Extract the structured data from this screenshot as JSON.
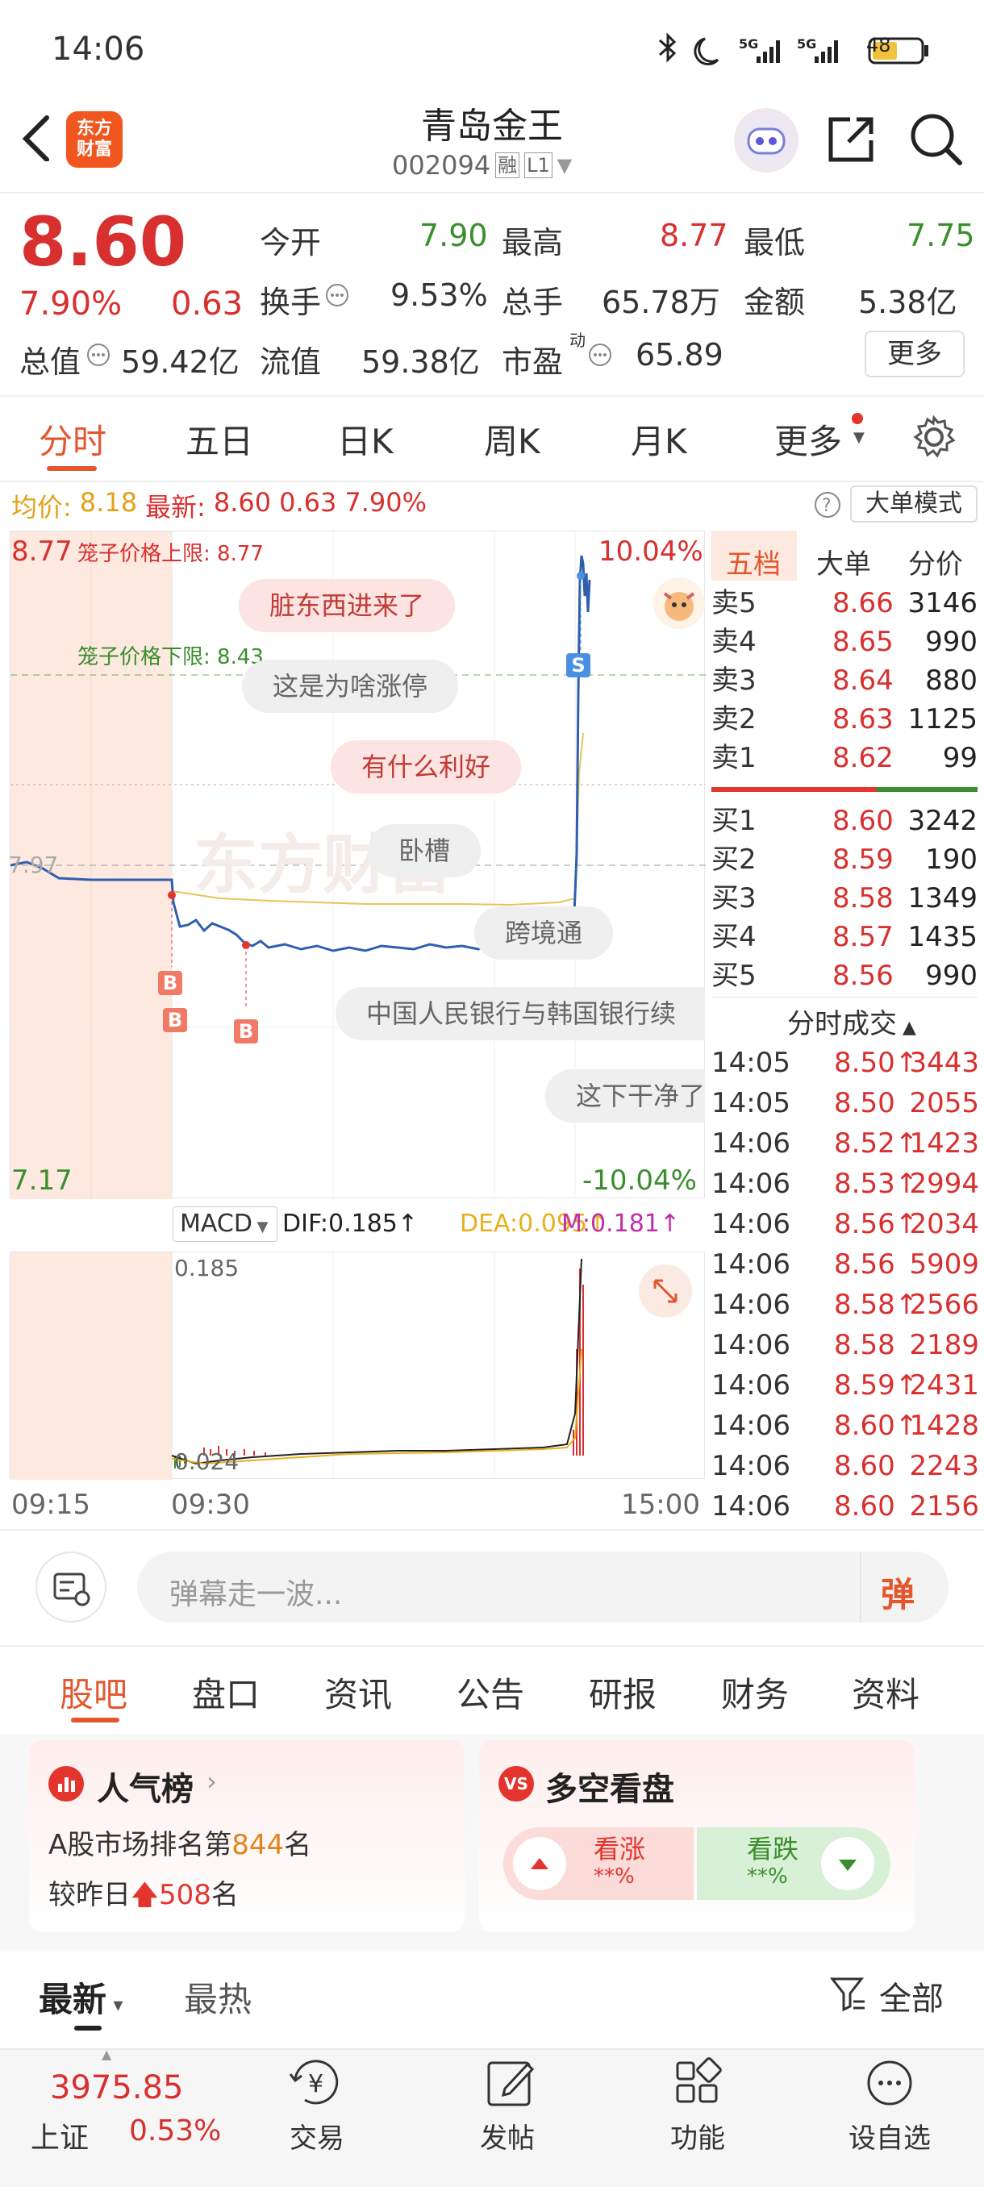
{
  "status_bar": {
    "time": "14:06",
    "network1": "5G",
    "network2": "5G",
    "battery": "48"
  },
  "header": {
    "logo_text_1": "东方",
    "logo_text_2": "财富",
    "title": "青岛金王",
    "code": "002094",
    "tag1": "融",
    "tag2": "L1"
  },
  "quote": {
    "price": "8.60",
    "change_pct": "7.90%",
    "change": "0.63",
    "open_label": "今开",
    "open": "7.90",
    "high_label": "最高",
    "high": "8.77",
    "low_label": "最低",
    "low": "7.75",
    "turnover_label": "换手",
    "turnover": "9.53%",
    "volume_label": "总手",
    "volume": "65.78万",
    "amount_label": "金额",
    "amount": "5.38亿",
    "mktcap_label": "总值",
    "mktcap": "59.42亿",
    "float_label": "流值",
    "float": "59.38亿",
    "pe_label": "市盈",
    "pe_sup": "动",
    "pe": "65.89",
    "more_button": "更多"
  },
  "tabs": {
    "t1": "分时",
    "t2": "五日",
    "t3": "日K",
    "t4": "周K",
    "t5": "月K",
    "t6": "更多"
  },
  "info_line": {
    "avg_label": "均价:",
    "avg": "8.18",
    "latest_label": "最新:",
    "latest": "8.60",
    "chg": "0.63",
    "pct": "7.90%",
    "mode_button": "大单模式"
  },
  "chart": {
    "top_price": "8.77",
    "top_pct": "10.04%",
    "bottom_price": "7.17",
    "bottom_pct": "-10.04%",
    "prev_close": "7.97",
    "upper_limit_label": "笼子价格上限: 8.77",
    "lower_limit_label": "笼子价格下限: 8.43",
    "watermark": "东方财富",
    "danmaku": [
      "脏东西进来了",
      "这是为啥涨停",
      "有什么利好",
      "卧槽",
      "跨境通",
      "中国人民银行与韩国银行续",
      "这下干净了"
    ],
    "x_start": "09:15",
    "x_mid": "09:30",
    "x_end": "15:00",
    "marker_b": "B",
    "marker_s": "S"
  },
  "macd": {
    "selector": "MACD",
    "dif": "DIF:0.185↑",
    "dea": "DEA:0.095↑",
    "m": "M:0.181↑",
    "top": "0.185",
    "bottom": "0.024"
  },
  "orderbook": {
    "tab1": "五档",
    "tab2": "大单",
    "tab3": "分价",
    "asks": [
      {
        "label": "卖5",
        "price": "8.66",
        "vol": "3146"
      },
      {
        "label": "卖4",
        "price": "8.65",
        "vol": "990"
      },
      {
        "label": "卖3",
        "price": "8.64",
        "vol": "880"
      },
      {
        "label": "卖2",
        "price": "8.63",
        "vol": "1125"
      },
      {
        "label": "卖1",
        "price": "8.62",
        "vol": "99"
      }
    ],
    "bids": [
      {
        "label": "买1",
        "price": "8.60",
        "vol": "3242"
      },
      {
        "label": "买2",
        "price": "8.59",
        "vol": "190"
      },
      {
        "label": "买3",
        "price": "8.58",
        "vol": "1349"
      },
      {
        "label": "买4",
        "price": "8.57",
        "vol": "1435"
      },
      {
        "label": "买5",
        "price": "8.56",
        "vol": "990"
      }
    ],
    "trades_title": "分时成交",
    "trades": [
      {
        "t": "14:05",
        "p": "8.50↑",
        "v": "3443"
      },
      {
        "t": "14:05",
        "p": "8.50",
        "v": "2055"
      },
      {
        "t": "14:06",
        "p": "8.52↑",
        "v": "1423"
      },
      {
        "t": "14:06",
        "p": "8.53↑",
        "v": "2994"
      },
      {
        "t": "14:06",
        "p": "8.56↑",
        "v": "2034"
      },
      {
        "t": "14:06",
        "p": "8.56",
        "v": "5909"
      },
      {
        "t": "14:06",
        "p": "8.58↑",
        "v": "2566"
      },
      {
        "t": "14:06",
        "p": "8.58",
        "v": "2189"
      },
      {
        "t": "14:06",
        "p": "8.59↑",
        "v": "2431"
      },
      {
        "t": "14:06",
        "p": "8.60↑",
        "v": "1428"
      },
      {
        "t": "14:06",
        "p": "8.60",
        "v": "2243"
      },
      {
        "t": "14:06",
        "p": "8.60",
        "v": "2156"
      }
    ]
  },
  "danmaku_input": {
    "placeholder": "弹幕走一波...",
    "button": "弹"
  },
  "section_tabs": [
    "股吧",
    "盘口",
    "资讯",
    "公告",
    "研报",
    "财务",
    "资料"
  ],
  "popularity": {
    "title": "人气榜",
    "line1_prefix": "A股市场排名第",
    "rank": "844",
    "line1_suffix": "名",
    "line2_prefix": "较昨日",
    "change": "508",
    "line2_suffix": "名"
  },
  "sentiment": {
    "title": "多空看盘",
    "up_label": "看涨",
    "up_val": "**%",
    "down_label": "看跌",
    "down_val": "**%"
  },
  "feed_tabs": {
    "latest": "最新",
    "hot": "最热",
    "filter": "全部"
  },
  "bottom_bar": {
    "index_value": "3975.85",
    "index_name": "上证",
    "index_pct": "0.53%",
    "trade": "交易",
    "post": "发帖",
    "func": "功能",
    "watchlist": "设自选"
  }
}
